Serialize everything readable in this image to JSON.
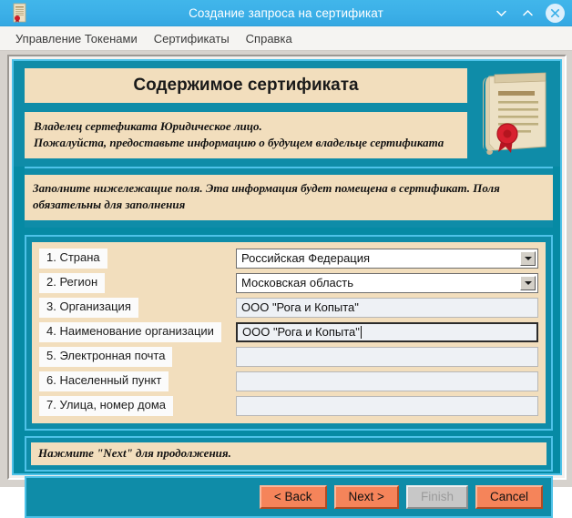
{
  "window": {
    "title": "Создание запроса на сертификат",
    "icon": "certificate-icon",
    "controls": {
      "minimize": "chevron-down-icon",
      "maximize": "chevron-up-icon",
      "close": "close-circle-icon"
    }
  },
  "menubar": {
    "items": [
      {
        "label": "Управление Токенами"
      },
      {
        "label": "Сертификаты"
      },
      {
        "label": "Справка"
      }
    ]
  },
  "header": {
    "title": "Содержимое сертификата",
    "subtitle_line1": "Владелец сертефиката Юридическое лицо.",
    "subtitle_line2": "Пожалуйста, предоставьте информацию о будущем владельце сертификата",
    "art_icon": "certificate-scroll-seal-icon"
  },
  "instructions": {
    "text": "Заполните нижележащие поля. Эта информация будет помещена в сертификат. Поля обязательны для заполнения"
  },
  "form": {
    "fields": [
      {
        "label": "1. Страна",
        "type": "combobox",
        "value": "Российская Федерация",
        "placeholder": "",
        "focused": false,
        "name": "country"
      },
      {
        "label": "2. Регион",
        "type": "combobox",
        "value": "Московская область",
        "placeholder": "",
        "focused": false,
        "name": "region"
      },
      {
        "label": "3. Организация",
        "type": "text",
        "value": "ООО \"Рога и Копыта\"",
        "placeholder": "",
        "focused": false,
        "name": "organization"
      },
      {
        "label": "4. Наименование организации",
        "type": "text",
        "value": "ООО \"Рога и Копыта\"",
        "placeholder": "",
        "focused": true,
        "name": "organization-unit"
      },
      {
        "label": "5. Электронная почта",
        "type": "text",
        "value": "",
        "placeholder": "",
        "focused": false,
        "name": "email"
      },
      {
        "label": "6. Населенный пункт",
        "type": "text",
        "value": "",
        "placeholder": "",
        "focused": false,
        "name": "locality"
      },
      {
        "label": "7. Улица, номер дома",
        "type": "text",
        "value": "",
        "placeholder": "",
        "focused": false,
        "name": "street-address"
      }
    ]
  },
  "hint": {
    "text": "Нажмите \"Next\" для продолжения."
  },
  "buttons": [
    {
      "label": "< Back",
      "name": "back-button",
      "disabled": false
    },
    {
      "label": "Next >",
      "name": "next-button",
      "disabled": false
    },
    {
      "label": "Finish",
      "name": "finish-button",
      "disabled": true
    },
    {
      "label": "Cancel",
      "name": "cancel-button",
      "disabled": false
    }
  ],
  "colors": {
    "titlebar": "#3cb0e8",
    "panel_teal": "#0f8ca8",
    "panel_border": "#4ec2e8",
    "content_beige": "#f2debd",
    "button_orange": "#f5845a",
    "button_disabled": "#c7c7c7",
    "seal_red": "#cc1c2a"
  }
}
